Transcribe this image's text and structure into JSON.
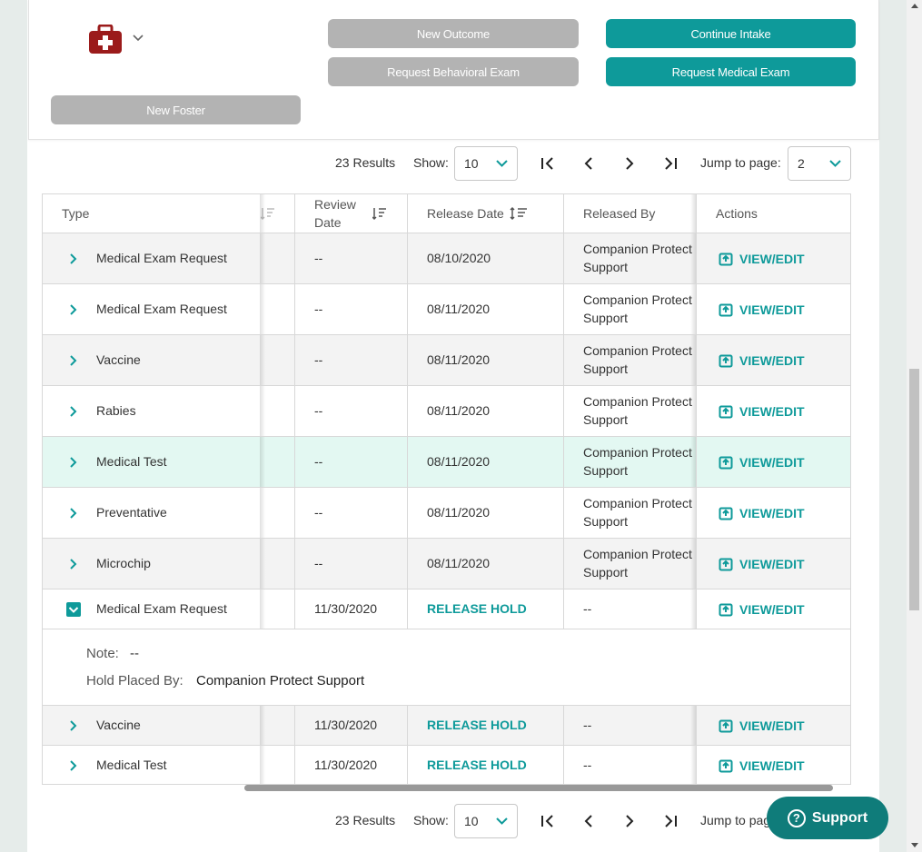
{
  "actions": {
    "new_outcome": "New Outcome",
    "continue_intake": "Continue Intake",
    "request_behavioral_exam": "Request Behavioral Exam",
    "request_medical_exam": "Request Medical Exam",
    "new_foster": "New Foster"
  },
  "icons": {
    "medical": "medical-kit-icon",
    "dropdown": "chevron-down-icon"
  },
  "colors": {
    "teal": "#0e9a9a",
    "gray_button": "#b3b3b3",
    "highlight_row": "#e3f8f2",
    "support": "#0f7c7a",
    "medical_icon": "#9b1b1b"
  },
  "pager_top": {
    "results": "23 Results",
    "show_label": "Show:",
    "show_value": "10",
    "jump_label": "Jump to page:",
    "jump_value": "2"
  },
  "pager_bottom": {
    "results": "23 Results",
    "show_label": "Show:",
    "show_value": "10",
    "jump_label": "Jump to pag"
  },
  "table": {
    "headers": {
      "type": "Type",
      "review_date_1": "Review",
      "review_date_2": "Date",
      "release_date": "Release Date",
      "released_by": "Released By",
      "actions": "Actions"
    },
    "rows": [
      {
        "type": "Medical Exam Request",
        "review": "--",
        "release": "08/10/2020",
        "by1": "Companion Protect",
        "by2": "Support",
        "action": "VIEW/EDIT"
      },
      {
        "type": "Medical Exam Request",
        "review": "--",
        "release": "08/11/2020",
        "by1": "Companion Protect",
        "by2": "Support",
        "action": "VIEW/EDIT"
      },
      {
        "type": "Vaccine",
        "review": "--",
        "release": "08/11/2020",
        "by1": "Companion Protect",
        "by2": "Support",
        "action": "VIEW/EDIT"
      },
      {
        "type": "Rabies",
        "review": "--",
        "release": "08/11/2020",
        "by1": "Companion Protect",
        "by2": "Support",
        "action": "VIEW/EDIT"
      },
      {
        "type": "Medical Test",
        "review": "--",
        "release": "08/11/2020",
        "by1": "Companion Protect",
        "by2": "Support",
        "action": "VIEW/EDIT"
      },
      {
        "type": "Preventative",
        "review": "--",
        "release": "08/11/2020",
        "by1": "Companion Protect",
        "by2": "Support",
        "action": "VIEW/EDIT"
      },
      {
        "type": "Microchip",
        "review": "--",
        "release": "08/11/2020",
        "by1": "Companion Protect",
        "by2": "Support",
        "action": "VIEW/EDIT"
      },
      {
        "type": "Medical Exam Request",
        "review": "11/30/2020",
        "release": "RELEASE HOLD",
        "by": "--",
        "action": "VIEW/EDIT"
      },
      {
        "type": "Vaccine",
        "review": "11/30/2020",
        "release": "RELEASE HOLD",
        "by": "--",
        "action": "VIEW/EDIT"
      },
      {
        "type": "Medical Test",
        "review": "11/30/2020",
        "release": "RELEASE HOLD",
        "by": "--",
        "action": "VIEW/EDIT"
      }
    ],
    "detail": {
      "note_label": "Note:",
      "note_value": "--",
      "hold_label": "Hold Placed By:",
      "hold_value": "Companion Protect Support"
    }
  },
  "support": {
    "label": "Support",
    "icon_glyph": "?"
  }
}
